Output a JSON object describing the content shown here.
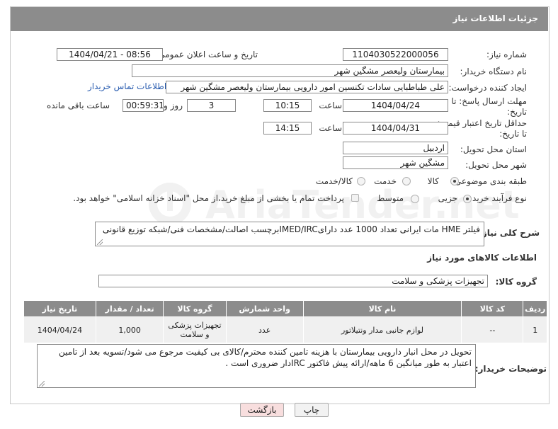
{
  "header": {
    "title": "جزئیات اطلاعات نیاز"
  },
  "form": {
    "need_number_label": "شماره نیاز:",
    "need_number": "1104030522000056",
    "announce_label": "تاریخ و ساعت اعلان عمومی:",
    "announce_value": "1404/04/21 - 08:56",
    "buyer_org_label": "نام دستگاه خریدار:",
    "buyer_org": "بیمارستان ولیعصر مشگین شهر",
    "creator_label": "ایجاد کننده درخواست:",
    "creator": "علی طباطبایی سادات تکنسین امور دارویی بیمارستان ولیعصر مشگین شهر",
    "contact_link": "اطلاعات تماس خریدار",
    "deadline_label_1": "مهلت ارسال پاسخ: تا",
    "deadline_label_2": "تاریخ:",
    "deadline_date": "1404/04/24",
    "time_label": "ساعت",
    "deadline_time": "10:15",
    "days_value": "3",
    "days_label": "روز و",
    "remaining_value": "00:59:31",
    "remaining_label": "ساعت باقی مانده",
    "validity_label_1": "حداقل تاریخ اعتبار قیمت:",
    "validity_label_2": "تا تاریخ:",
    "validity_date": "1404/04/31",
    "validity_time_label": "ساعت",
    "validity_time": "14:15",
    "province_label": "استان محل تحویل:",
    "province": "اردبیل",
    "city_label": "شهر محل تحویل:",
    "city": "مشگین شهر",
    "category_label": "طبقه بندی موضوعی:",
    "category_options": [
      "کالا",
      "خدمت",
      "کالا/خدمت"
    ],
    "category_selected": "کالا",
    "process_label": "نوع فرآیند خرید :",
    "process_options": [
      "جزیی",
      "متوسط"
    ],
    "process_selected": "جزیی",
    "payment_note": "پرداخت تمام یا بخشی از مبلغ خرید،از محل \"اسناد خزانه اسلامی\" خواهد بود.",
    "summary_label": "شرح کلی نیاز:",
    "summary": "فیلتر HME مات ایرانی تعداد 1000 عدد دارایIMED/IRCبرچسب اصالت/مشخصات فنی/شبکه توزیع قانونی"
  },
  "goods": {
    "section_title": "اطلاعات کالاهای مورد نیاز",
    "group_label": "گروه کالا:",
    "group_value": "تجهیزات پزشکی و سلامت",
    "columns": [
      "ردیف",
      "کد کالا",
      "نام کالا",
      "واحد شمارش",
      "گروه کالا",
      "تعداد / مقدار",
      "تاریخ نیاز"
    ],
    "rows": [
      {
        "row": "1",
        "code": "--",
        "name": "لوازم جانبی مدار ونتیلاتور",
        "unit": "عدد",
        "group": "تجهیزات پزشکی و سلامت",
        "qty": "1,000",
        "date": "1404/04/24"
      }
    ]
  },
  "buyer_notes": {
    "label": "توضیحات خریدار:",
    "text": "تحویل در محل انبار دارویی بیمارستان با هزینه تامین کننده محترم/کالای بی کیفیت مرجوع می شود/تسویه بعد از تامین اعتبار به طور میانگین 6 ماهه/ارائه پیش فاکتور IRCدار ضروری است ."
  },
  "buttons": {
    "print": "چاپ",
    "back": "بازگشت"
  },
  "watermark": {
    "text": "AriaTender.net"
  },
  "colors": {
    "header_bg": "#8c8c8c",
    "link": "#2a5db0",
    "back_btn_bg": "#f8dede"
  },
  "icons": {
    "resize_grip": "resize-grip-icon",
    "watermark_logo": "ariatender-logo-icon"
  }
}
